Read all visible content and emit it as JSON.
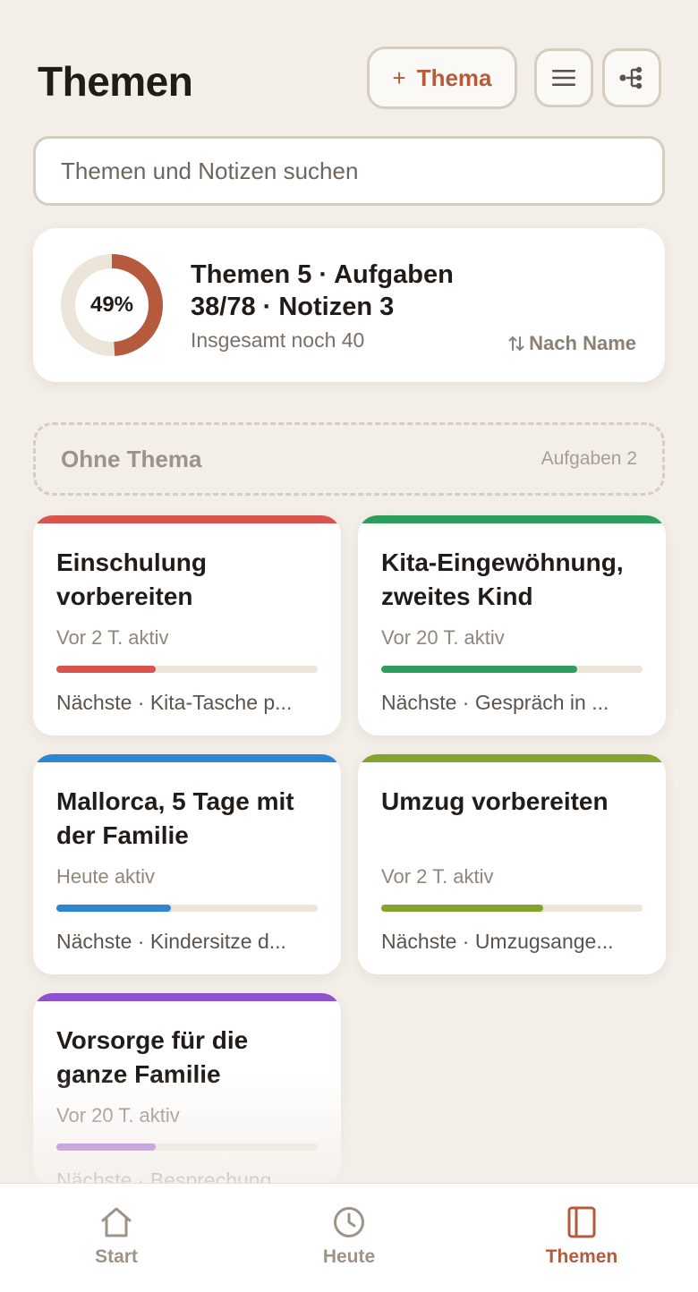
{
  "header": {
    "title": "Themen",
    "add_label": "Thema",
    "add_plus": "+"
  },
  "search": {
    "placeholder": "Themen und Notizen suchen"
  },
  "summary": {
    "percent_label": "49%",
    "percent": 49,
    "headline": "Themen 5 · Aufgaben 38/78 · Notizen 3",
    "sub": "Insgesamt noch 40",
    "sort_label": "Nach Name",
    "sort_icon": "sort-icon"
  },
  "no_topic": {
    "title": "Ohne Thema",
    "count": "Aufgaben 2"
  },
  "topics": [
    {
      "title": "Einschulung vorbereiten",
      "active": "Vor 2 T. aktiv",
      "next": "Nächste · Kita-Tasche p...",
      "color": "#d9534f",
      "progress": 0.38
    },
    {
      "title": "Kita-Eingewöhnung, zweites Kind",
      "active": "Vor 20 T. aktiv",
      "next": "Nächste · Gespräch in ...",
      "color": "#2e9e5e",
      "progress": 0.75
    },
    {
      "title": "Mallorca, 5 Tage mit der Familie",
      "active": "Heute aktiv",
      "next": "Nächste · Kindersitze d...",
      "color": "#2f86d0",
      "progress": 0.44
    },
    {
      "title": "Umzug vorbereiten",
      "active": "Vor 2 T. aktiv",
      "next": "Nächste · Umzugsange...",
      "color": "#86a32e",
      "progress": 0.62
    },
    {
      "title": "Vorsorge für die ganze Familie",
      "active": "Vor 20 T. aktiv",
      "next": "Nächste · Besprechung ...",
      "color": "#8e4fd1",
      "progress": 0.38
    }
  ],
  "tabs": [
    {
      "label": "Start",
      "icon": "home-icon"
    },
    {
      "label": "Heute",
      "icon": "clock-icon"
    },
    {
      "label": "Themen",
      "icon": "notebook-icon",
      "active": true
    }
  ],
  "colors": {
    "accent": "#b55a3c",
    "background": "#f3eee8"
  }
}
